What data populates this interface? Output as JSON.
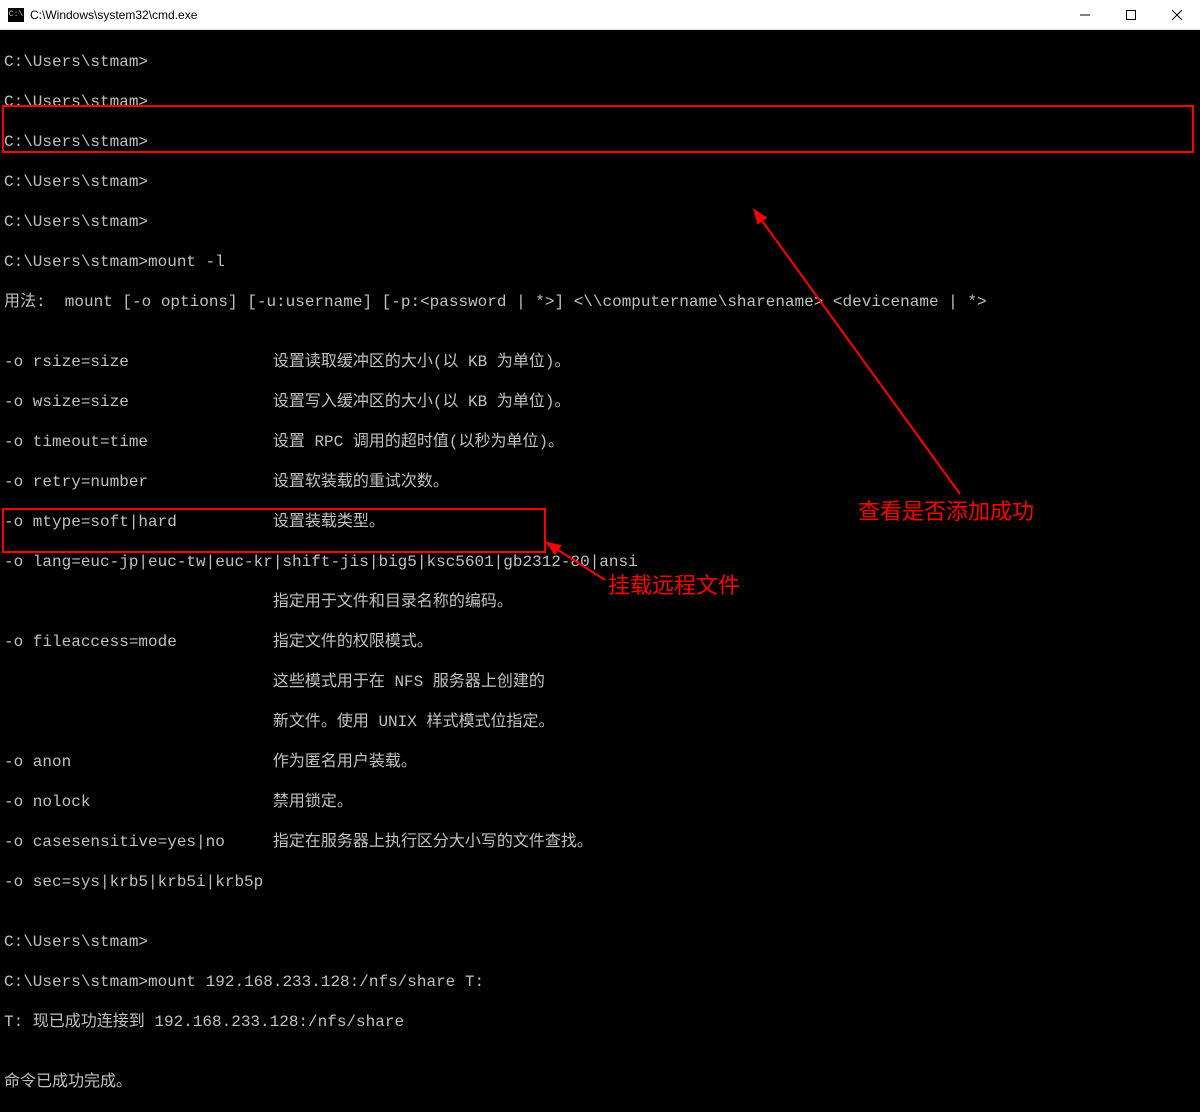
{
  "window": {
    "title": "C:\\Windows\\system32\\cmd.exe"
  },
  "prompt": "C:\\Users\\stmam>",
  "lines": {
    "p1": "C:\\Users\\stmam>",
    "p2": "C:\\Users\\stmam>",
    "p3": "C:\\Users\\stmam>",
    "p4": "C:\\Users\\stmam>",
    "p5": "C:\\Users\\stmam>",
    "cmd1": "C:\\Users\\stmam>mount -l",
    "usage": "用法:  mount [-o options] [-u:username] [-p:<password | *>] <\\\\computername\\sharename> <devicename | *>",
    "blank": "",
    "o1": "-o rsize=size               设置读取缓冲区的大小(以 KB 为单位)。",
    "o2": "-o wsize=size               设置写入缓冲区的大小(以 KB 为单位)。",
    "o3": "-o timeout=time             设置 RPC 调用的超时值(以秒为单位)。",
    "o4": "-o retry=number             设置软装载的重试次数。",
    "o5": "-o mtype=soft|hard          设置装载类型。",
    "o6": "-o lang=euc-jp|euc-tw|euc-kr|shift-jis|big5|ksc5601|gb2312-80|ansi",
    "o7": "                            指定用于文件和目录名称的编码。",
    "o8": "-o fileaccess=mode          指定文件的权限模式。",
    "o9": "                            这些模式用于在 NFS 服务器上创建的",
    "o10": "                            新文件。使用 UNIX 样式模式位指定。",
    "o11": "-o anon                     作为匿名用户装载。",
    "o12": "-o nolock                   禁用锁定。",
    "o13": "-o casesensitive=yes|no     指定在服务器上执行区分大小写的文件查找。",
    "o14": "-o sec=sys|krb5|krb5i|krb5p",
    "p6": "C:\\Users\\stmam>",
    "cmd2": "C:\\Users\\stmam>mount 192.168.233.128:/nfs/share T:",
    "res": "T: 现已成功连接到 192.168.233.128:/nfs/share",
    "done": "命令已成功完成。"
  },
  "annotations": {
    "check_success": "查看是否添加成功",
    "mount_remote": "挂载远程文件"
  }
}
